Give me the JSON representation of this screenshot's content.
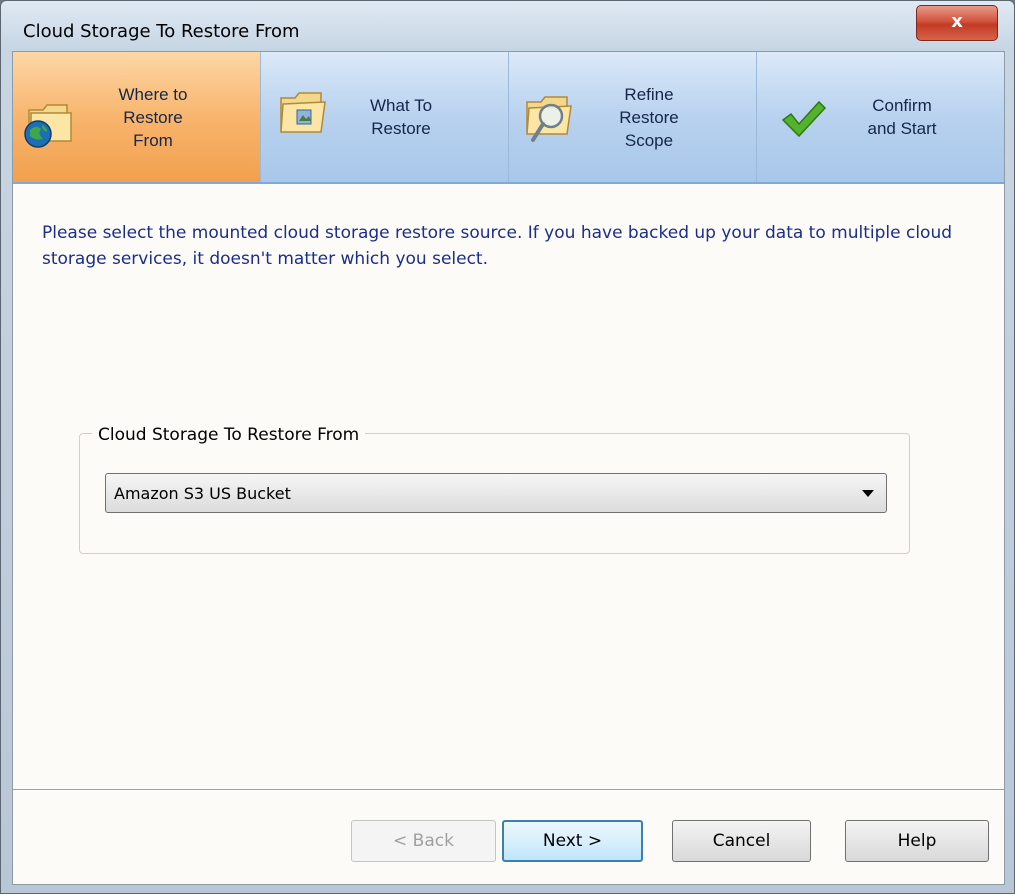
{
  "window": {
    "title": "Cloud Storage To Restore From",
    "close_symbol": "x"
  },
  "steps": [
    {
      "label": "Where to\nRestore\nFrom",
      "icon": "globe-folder-icon",
      "active": true
    },
    {
      "label": "What To\nRestore",
      "icon": "folder-icon",
      "active": false
    },
    {
      "label": "Refine\nRestore\nScope",
      "icon": "search-folder-icon",
      "active": false
    },
    {
      "label": "Confirm\nand Start",
      "icon": "checkmark-icon",
      "active": false
    }
  ],
  "instruction": "Please select the mounted cloud storage restore source. If you have backed up your data to multiple cloud storage services, it doesn't matter which you select.",
  "group": {
    "legend": "Cloud Storage To Restore From",
    "selected_value": "Amazon S3 US Bucket"
  },
  "buttons": {
    "back": "< Back",
    "next": "Next >",
    "cancel": "Cancel",
    "help": "Help"
  },
  "colors": {
    "active_step": "#f8b56d",
    "step": "#b8d2ef",
    "instruction_text": "#1a2e8a",
    "close_button": "#c23b24"
  }
}
